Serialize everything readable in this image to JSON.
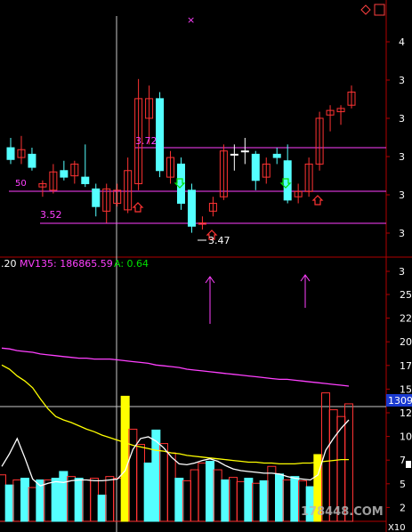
{
  "colors": {
    "background": "#000000",
    "up": "#ff3333",
    "down": "#54ffff",
    "flat": "#ffffff",
    "frame": "#b00000",
    "magenta": "#ff40ff",
    "yellow": "#ffff00",
    "green": "#00e000",
    "crosshair": "#c8c8c8",
    "highlight": "#ffff00",
    "box_blue": "#1a3ad0"
  },
  "price_panel": {
    "high_label": "3.72",
    "low_label_left": "3.52",
    "low_label_bottom": "3.47",
    "ma_fragment": "50",
    "axis_ticks": [
      "4",
      "3",
      "3",
      "3",
      "3",
      "3",
      "3"
    ],
    "top_marker": "×"
  },
  "volume_panel": {
    "indicator_prefix": ".20",
    "mv_label": "MV135: 186865.59",
    "a_label": "A: 0.64",
    "axis_ticks": [
      "25",
      "22",
      "20",
      "17",
      "15",
      "12",
      "10",
      "7",
      "5",
      "2"
    ],
    "current_box": "1309",
    "corner_label": "X10"
  },
  "watermark": "178448.COM",
  "chart_data": {
    "type": "candlestick",
    "candles": [
      {
        "o": 3.595,
        "h": 3.61,
        "l": 3.57,
        "c": 3.577
      },
      {
        "o": 3.58,
        "h": 3.613,
        "l": 3.57,
        "c": 3.592
      },
      {
        "o": 3.585,
        "h": 3.595,
        "l": 3.56,
        "c": 3.565
      },
      {
        "o": 3.535,
        "h": 3.545,
        "l": 3.52,
        "c": 3.54
      },
      {
        "o": 3.53,
        "h": 3.57,
        "l": 3.525,
        "c": 3.558
      },
      {
        "o": 3.56,
        "h": 3.575,
        "l": 3.545,
        "c": 3.55
      },
      {
        "o": 3.552,
        "h": 3.575,
        "l": 3.54,
        "c": 3.57
      },
      {
        "o": 3.55,
        "h": 3.6,
        "l": 3.535,
        "c": 3.54
      },
      {
        "o": 3.532,
        "h": 3.54,
        "l": 3.49,
        "c": 3.505
      },
      {
        "o": 3.498,
        "h": 3.54,
        "l": 3.48,
        "c": 3.532
      },
      {
        "o": 3.51,
        "h": 3.54,
        "l": 3.505,
        "c": 3.53
      },
      {
        "o": 3.5,
        "h": 3.58,
        "l": 3.495,
        "c": 3.56
      },
      {
        "o": 3.54,
        "h": 3.7,
        "l": 3.53,
        "c": 3.67
      },
      {
        "o": 3.64,
        "h": 3.69,
        "l": 3.6,
        "c": 3.67
      },
      {
        "o": 3.67,
        "h": 3.68,
        "l": 3.55,
        "c": 3.56
      },
      {
        "o": 3.55,
        "h": 3.59,
        "l": 3.54,
        "c": 3.58
      },
      {
        "o": 3.57,
        "h": 3.58,
        "l": 3.5,
        "c": 3.51
      },
      {
        "o": 3.53,
        "h": 3.54,
        "l": 3.465,
        "c": 3.475
      },
      {
        "o": 3.478,
        "h": 3.49,
        "l": 3.47,
        "c": 3.48
      },
      {
        "o": 3.498,
        "h": 3.52,
        "l": 3.49,
        "c": 3.51
      },
      {
        "o": 3.52,
        "h": 3.6,
        "l": 3.515,
        "c": 3.59
      },
      {
        "o": 3.585,
        "h": 3.6,
        "l": 3.56,
        "c": 3.585
      },
      {
        "o": 3.59,
        "h": 3.61,
        "l": 3.57,
        "c": 3.59
      },
      {
        "o": 3.585,
        "h": 3.59,
        "l": 3.53,
        "c": 3.545
      },
      {
        "o": 3.55,
        "h": 3.58,
        "l": 3.54,
        "c": 3.57
      },
      {
        "o": 3.585,
        "h": 3.595,
        "l": 3.57,
        "c": 3.58
      },
      {
        "o": 3.575,
        "h": 3.6,
        "l": 3.51,
        "c": 3.515
      },
      {
        "o": 3.52,
        "h": 3.54,
        "l": 3.51,
        "c": 3.528
      },
      {
        "o": 3.528,
        "h": 3.58,
        "l": 3.52,
        "c": 3.57
      },
      {
        "o": 3.57,
        "h": 3.65,
        "l": 3.56,
        "c": 3.64
      },
      {
        "o": 3.645,
        "h": 3.66,
        "l": 3.62,
        "c": 3.652
      },
      {
        "o": 3.65,
        "h": 3.66,
        "l": 3.63,
        "c": 3.655
      },
      {
        "o": 3.66,
        "h": 3.69,
        "l": 3.655,
        "c": 3.68
      }
    ],
    "price_range": [
      3.44,
      3.78
    ],
    "volume_range": [
      0,
      28
    ],
    "volumes": [
      5.5,
      4.3,
      4.9,
      5.1,
      4.0,
      4.9,
      4.9,
      5.1,
      5.9,
      5.3,
      5.1,
      4.9,
      5.1,
      3.1,
      5.3,
      5.1,
      14.8,
      10.9,
      9.1,
      6.9,
      10.8,
      9.2,
      8.1,
      5.1,
      4.8,
      6.1,
      6.9,
      7.1,
      6.1,
      4.9,
      5.2,
      4.7,
      5.1,
      4.5,
      4.8,
      6.5,
      5.6,
      4.9,
      5.3,
      4.8,
      4.1,
      7.9,
      15.2,
      13.2,
      12.4,
      13.9
    ],
    "volume_up": [
      true,
      false,
      true,
      false,
      true,
      false,
      true,
      false,
      false,
      true,
      false,
      true,
      true,
      false,
      true,
      true,
      true,
      true,
      true,
      false,
      false,
      true,
      true,
      false,
      true,
      true,
      true,
      false,
      true,
      false,
      true,
      true,
      false,
      true,
      false,
      true,
      false,
      true,
      false,
      true,
      false,
      true,
      true,
      true,
      true,
      true
    ],
    "volume_highlight_index": [
      16,
      41
    ],
    "mv_series_1": [
      20.5,
      20.4,
      20.2,
      20.1,
      20.0,
      19.8,
      19.7,
      19.6,
      19.5,
      19.4,
      19.3,
      19.3,
      19.2,
      19.2,
      19.2,
      19.1,
      19.0,
      18.9,
      18.8,
      18.7,
      18.5,
      18.4,
      18.3,
      18.2,
      18.0,
      17.9,
      17.8,
      17.7,
      17.6,
      17.5,
      17.4,
      17.3,
      17.2,
      17.1,
      17.0,
      16.9,
      16.8,
      16.8,
      16.7,
      16.6,
      16.5,
      16.4,
      16.3,
      16.2,
      16.1,
      16.0
    ],
    "mv_series_2": [
      18.5,
      18.0,
      17.2,
      16.6,
      15.8,
      14.5,
      13.3,
      12.4,
      12.0,
      11.7,
      11.3,
      10.9,
      10.6,
      10.2,
      9.9,
      9.6,
      9.3,
      9.0,
      8.8,
      8.6,
      8.4,
      8.3,
      8.1,
      8.0,
      7.8,
      7.7,
      7.6,
      7.5,
      7.4,
      7.3,
      7.2,
      7.1,
      7.0,
      7.0,
      6.9,
      6.9,
      6.8,
      6.8,
      6.8,
      6.9,
      6.9,
      7.0,
      7.1,
      7.2,
      7.3,
      7.3
    ],
    "mv_series_3": [
      6.5,
      8.0,
      9.8,
      7.5,
      5.0,
      4.2,
      4.5,
      4.7,
      4.6,
      4.8,
      4.9,
      4.9,
      4.8,
      4.8,
      4.9,
      5.0,
      6.0,
      8.5,
      9.8,
      10.0,
      9.5,
      8.7,
      7.6,
      6.8,
      6.7,
      6.9,
      7.2,
      7.4,
      7.1,
      6.6,
      6.2,
      6.0,
      5.9,
      5.8,
      5.7,
      5.7,
      5.6,
      5.3,
      5.1,
      5.0,
      4.9,
      5.5,
      8.4,
      9.8,
      11.0,
      12.0
    ]
  }
}
